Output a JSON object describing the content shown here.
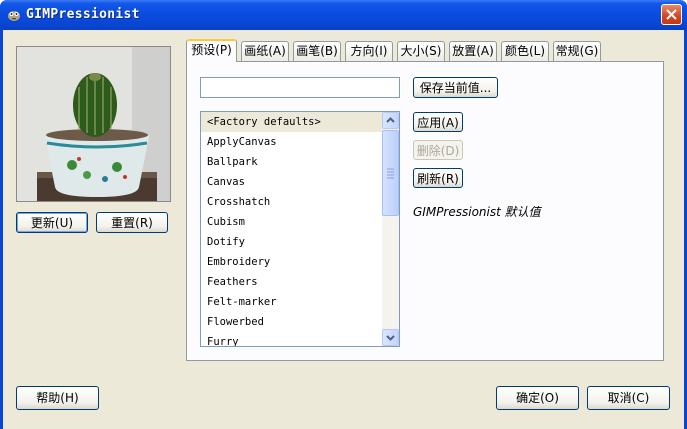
{
  "window": {
    "title": "GIMPressionist"
  },
  "preview": {
    "update_label": "更新(U)",
    "reset_label": "重置(R)"
  },
  "tabs": [
    {
      "label": "预设(P)"
    },
    {
      "label": "画纸(A)"
    },
    {
      "label": "画笔(B)"
    },
    {
      "label": "方向(I)"
    },
    {
      "label": "大小(S)"
    },
    {
      "label": "放置(A)"
    },
    {
      "label": "颜色(L)"
    },
    {
      "label": "常规(G)"
    }
  ],
  "presets": {
    "name_value": "",
    "save_label": "保存当前值...",
    "apply_label": "应用(A)",
    "delete_label": "删除(D)",
    "refresh_label": "刷新(R)",
    "status_text": "GIMPressionist 默认值",
    "items": [
      "<Factory defaults>",
      "ApplyCanvas",
      "Ballpark",
      "Canvas",
      "Crosshatch",
      "Cubism",
      "Dotify",
      "Embroidery",
      "Feathers",
      "Felt-marker",
      "Flowerbed",
      "Furry"
    ]
  },
  "footer": {
    "help_label": "帮助(H)",
    "ok_label": "确定(O)",
    "cancel_label": "取消(C)"
  },
  "colors": {
    "titlebar": "#0a4be0",
    "dialog_bg": "#ece9d8",
    "tab_accent": "#ffc83c"
  }
}
